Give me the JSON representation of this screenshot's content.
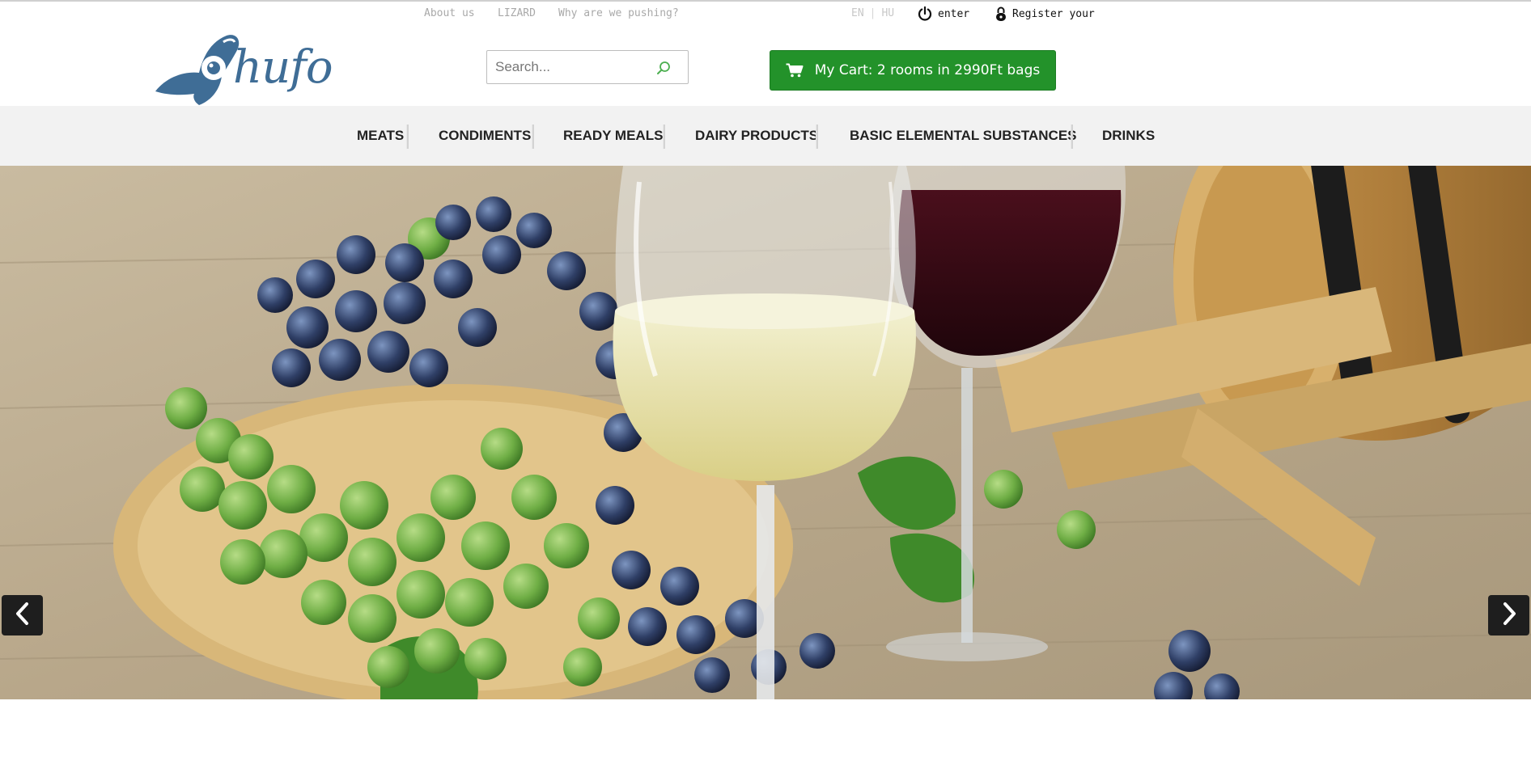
{
  "top_links": {
    "about": "About us",
    "lizard": "LIZARD",
    "why": "Why are we pushing?"
  },
  "language": {
    "en": "EN",
    "separator": "|",
    "hu": "HU"
  },
  "account": {
    "enter": "enter",
    "register": "Register your"
  },
  "logo": {
    "text": "hufo"
  },
  "search": {
    "placeholder": "Search..."
  },
  "cart": {
    "label": "My Cart: 2 rooms in 2990Ft bags"
  },
  "nav": {
    "items": [
      {
        "label": "MEATS"
      },
      {
        "label": "CONDIMENTS"
      },
      {
        "label": "READY MEALS"
      },
      {
        "label": "DAIRY PRODUCTS"
      },
      {
        "label": "BASIC ELEMENTAL SUBSTANCES"
      },
      {
        "label": "DRINKS"
      }
    ]
  },
  "colors": {
    "brand": "#3f6d96",
    "cart_green": "#23922a",
    "nav_background": "#f2f2f2",
    "arrow_background": "#1e1e1e"
  },
  "icons": {
    "search": "search-icon",
    "cart": "cart-icon",
    "power": "power-icon",
    "lock": "lock-icon",
    "prev": "chevron-left-icon",
    "next": "chevron-right-icon"
  }
}
